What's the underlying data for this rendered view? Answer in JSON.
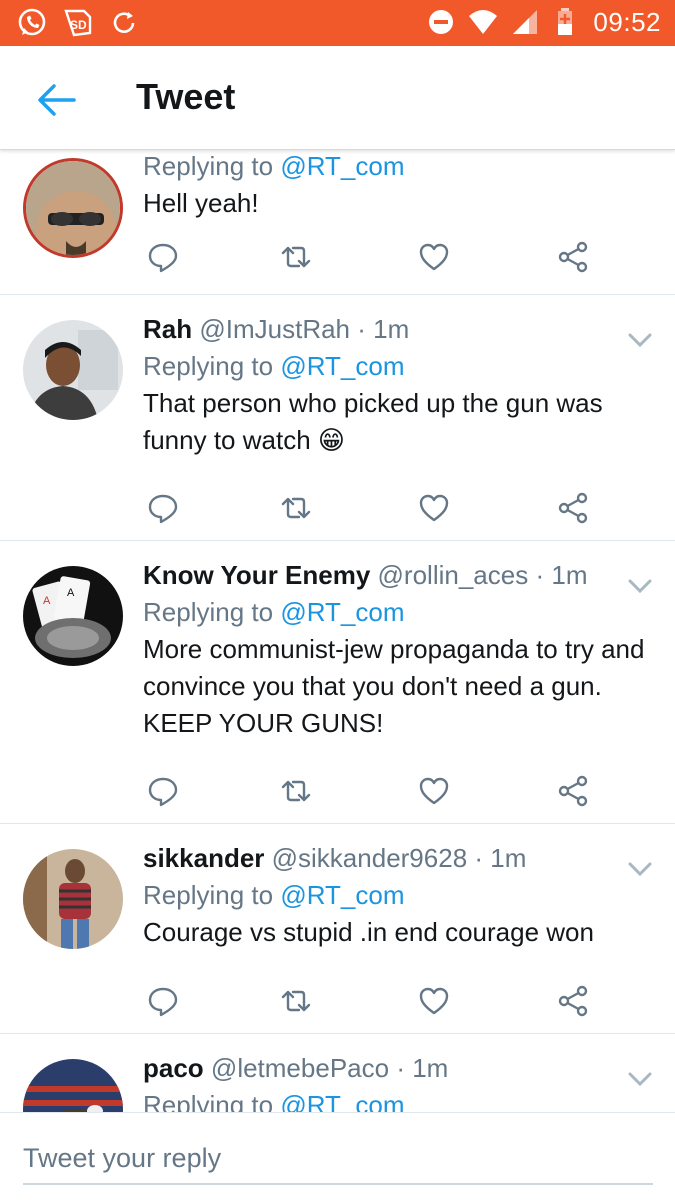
{
  "status_bar": {
    "time": "09:52",
    "icons": [
      "whatsapp-icon",
      "sd-card-icon",
      "sync-icon",
      "do-not-disturb-icon",
      "wifi-icon",
      "signal-icon",
      "battery-charging-icon"
    ],
    "bar_color": "#f1592a"
  },
  "header": {
    "title": "Tweet",
    "back_icon": "back-arrow-icon"
  },
  "colors": {
    "accent": "#1b95e0",
    "secondary_text": "#657786"
  },
  "tweets": [
    {
      "name": "",
      "handle": "",
      "time": "",
      "replying_prefix": "Replying to ",
      "replying_to": "@RT_com",
      "text": "Hell yeah!"
    },
    {
      "name": "Rah",
      "handle": "@ImJustRah",
      "dot": "·",
      "time": "1m",
      "replying_prefix": "Replying to ",
      "replying_to": "@RT_com",
      "text": "That person who picked up the gun was funny to watch 😁"
    },
    {
      "name": "Know Your Enemy",
      "handle": "@rollin_aces",
      "dot": "·",
      "time": "1m",
      "replying_prefix": "Replying to ",
      "replying_to": "@RT_com",
      "text": "More communist-jew propaganda to try and convince you that you don't need a gun. KEEP YOUR GUNS!"
    },
    {
      "name": "sikkander",
      "handle": "@sikkander9628",
      "dot": "·",
      "time": "1m",
      "replying_prefix": "Replying to ",
      "replying_to": "@RT_com",
      "text": "Courage vs stupid .in end courage won"
    },
    {
      "name": "paco",
      "handle": "@letmebePaco",
      "dot": "·",
      "time": "1m",
      "replying_prefix": "Replying to ",
      "replying_to": "@RT_com",
      "text": ""
    }
  ],
  "actions": [
    "reply-icon",
    "retweet-icon",
    "like-icon",
    "share-icon"
  ],
  "composer": {
    "placeholder": "Tweet your reply"
  }
}
